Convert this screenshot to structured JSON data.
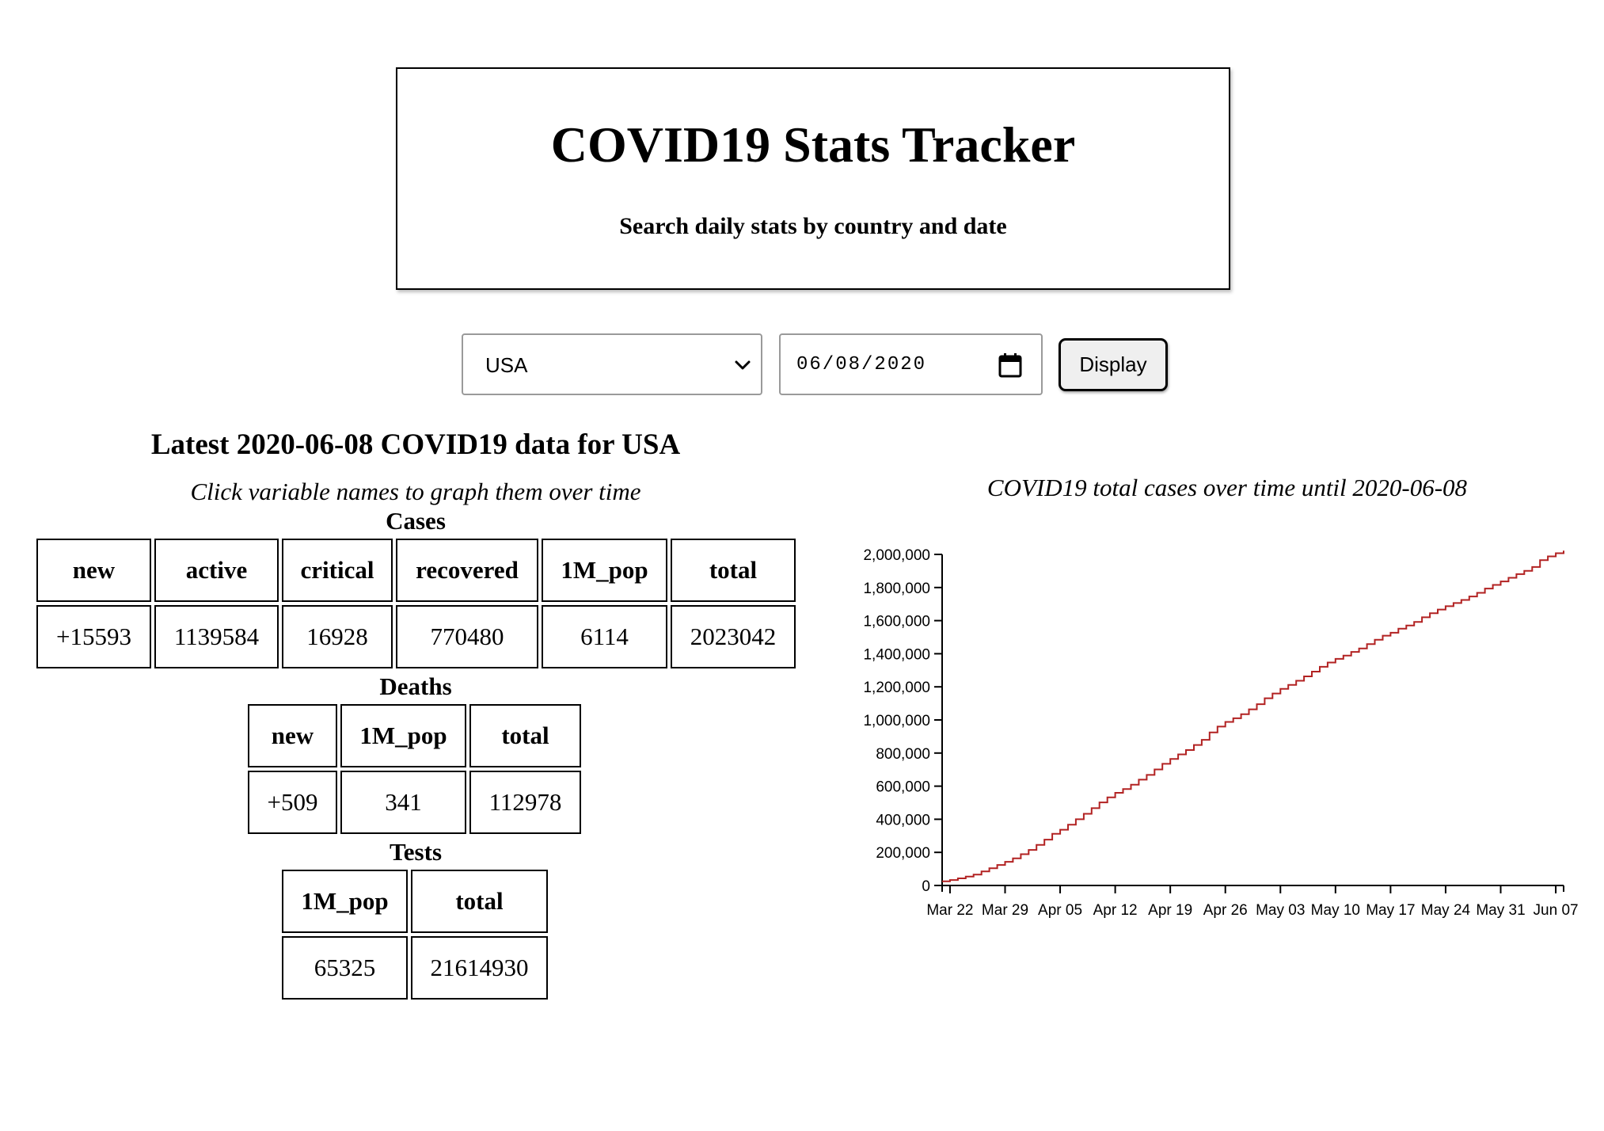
{
  "header": {
    "title": "COVID19 Stats Tracker",
    "subtitle": "Search daily stats by country and date"
  },
  "controls": {
    "country": "USA",
    "date": "06/08/2020",
    "display_label": "Display"
  },
  "results": {
    "heading": "Latest 2020-06-08 COVID19 data for USA",
    "instruction": "Click variable names to graph them over time",
    "groups": [
      {
        "title": "Cases",
        "headers": [
          "new",
          "active",
          "critical",
          "recovered",
          "1M_pop",
          "total"
        ],
        "values": [
          "+15593",
          "1139584",
          "16928",
          "770480",
          "6114",
          "2023042"
        ]
      },
      {
        "title": "Deaths",
        "headers": [
          "new",
          "1M_pop",
          "total"
        ],
        "values": [
          "+509",
          "341",
          "112978"
        ]
      },
      {
        "title": "Tests",
        "headers": [
          "1M_pop",
          "total"
        ],
        "values": [
          "65325",
          "21614930"
        ]
      }
    ]
  },
  "chart_data": {
    "type": "line",
    "title": "COVID19 total cases over time until 2020-06-08",
    "xlabel": "",
    "ylabel": "",
    "line_color": "#b22222",
    "x_ticks": [
      "Mar 22",
      "Mar 29",
      "Apr 05",
      "Apr 12",
      "Apr 19",
      "Apr 26",
      "May 03",
      "May 10",
      "May 17",
      "May 24",
      "May 31",
      "Jun 07"
    ],
    "y_ticks": [
      "0",
      "200,000",
      "400,000",
      "600,000",
      "800,000",
      "1,000,000",
      "1,200,000",
      "1,400,000",
      "1,600,000",
      "1,800,000",
      "2,000,000"
    ],
    "ylim": [
      0,
      2000000
    ],
    "xlim": [
      "2020-03-21",
      "2020-06-08"
    ],
    "step": true,
    "series": [
      {
        "points": [
          [
            "2020-03-21",
            25000
          ],
          [
            "2020-03-22",
            33000
          ],
          [
            "2020-03-23",
            43000
          ],
          [
            "2020-03-24",
            54000
          ],
          [
            "2020-03-25",
            66000
          ],
          [
            "2020-03-26",
            85000
          ],
          [
            "2020-03-27",
            104000
          ],
          [
            "2020-03-28",
            124000
          ],
          [
            "2020-03-29",
            143000
          ],
          [
            "2020-03-30",
            164000
          ],
          [
            "2020-03-31",
            189000
          ],
          [
            "2020-04-01",
            215000
          ],
          [
            "2020-04-02",
            245000
          ],
          [
            "2020-04-03",
            277000
          ],
          [
            "2020-04-04",
            312000
          ],
          [
            "2020-04-05",
            337000
          ],
          [
            "2020-04-06",
            367000
          ],
          [
            "2020-04-07",
            400000
          ],
          [
            "2020-04-08",
            433000
          ],
          [
            "2020-04-09",
            467000
          ],
          [
            "2020-04-10",
            502000
          ],
          [
            "2020-04-11",
            532000
          ],
          [
            "2020-04-12",
            560000
          ],
          [
            "2020-04-13",
            583000
          ],
          [
            "2020-04-14",
            609000
          ],
          [
            "2020-04-15",
            639000
          ],
          [
            "2020-04-16",
            668000
          ],
          [
            "2020-04-17",
            701000
          ],
          [
            "2020-04-18",
            735000
          ],
          [
            "2020-04-19",
            764000
          ],
          [
            "2020-04-20",
            792000
          ],
          [
            "2020-04-21",
            818000
          ],
          [
            "2020-04-22",
            849000
          ],
          [
            "2020-04-23",
            880000
          ],
          [
            "2020-04-24",
            925000
          ],
          [
            "2020-04-25",
            960000
          ],
          [
            "2020-04-26",
            988000
          ],
          [
            "2020-04-27",
            1010000
          ],
          [
            "2020-04-28",
            1035000
          ],
          [
            "2020-04-29",
            1064000
          ],
          [
            "2020-04-30",
            1095000
          ],
          [
            "2020-05-01",
            1131000
          ],
          [
            "2020-05-02",
            1160000
          ],
          [
            "2020-05-03",
            1188000
          ],
          [
            "2020-05-04",
            1212000
          ],
          [
            "2020-05-05",
            1237000
          ],
          [
            "2020-05-06",
            1263000
          ],
          [
            "2020-05-07",
            1292000
          ],
          [
            "2020-05-08",
            1321000
          ],
          [
            "2020-05-09",
            1347000
          ],
          [
            "2020-05-10",
            1369000
          ],
          [
            "2020-05-11",
            1389000
          ],
          [
            "2020-05-12",
            1411000
          ],
          [
            "2020-05-13",
            1432000
          ],
          [
            "2020-05-14",
            1458000
          ],
          [
            "2020-05-15",
            1484000
          ],
          [
            "2020-05-16",
            1509000
          ],
          [
            "2020-05-17",
            1527000
          ],
          [
            "2020-05-18",
            1551000
          ],
          [
            "2020-05-19",
            1571000
          ],
          [
            "2020-05-20",
            1592000
          ],
          [
            "2020-05-21",
            1620000
          ],
          [
            "2020-05-22",
            1645000
          ],
          [
            "2020-05-23",
            1667000
          ],
          [
            "2020-05-24",
            1687000
          ],
          [
            "2020-05-25",
            1706000
          ],
          [
            "2020-05-26",
            1725000
          ],
          [
            "2020-05-27",
            1746000
          ],
          [
            "2020-05-28",
            1768000
          ],
          [
            "2020-05-29",
            1794000
          ],
          [
            "2020-05-30",
            1816000
          ],
          [
            "2020-05-31",
            1837000
          ],
          [
            "2020-06-01",
            1859000
          ],
          [
            "2020-06-02",
            1881000
          ],
          [
            "2020-06-03",
            1901000
          ],
          [
            "2020-06-04",
            1924000
          ],
          [
            "2020-06-05",
            1965000
          ],
          [
            "2020-06-06",
            1988000
          ],
          [
            "2020-06-07",
            2007000
          ],
          [
            "2020-06-08",
            2023042
          ]
        ]
      }
    ]
  }
}
